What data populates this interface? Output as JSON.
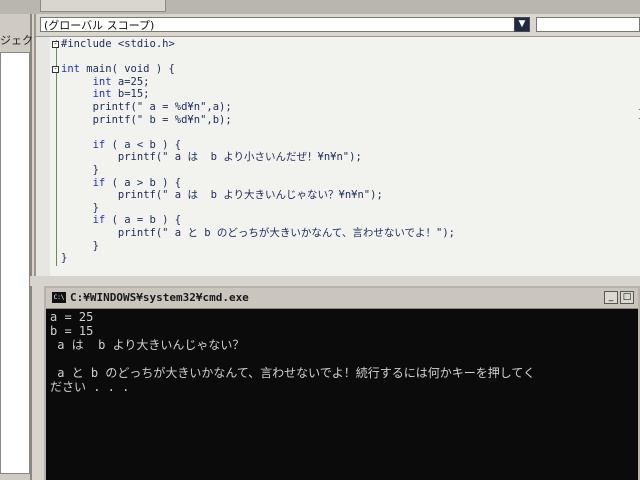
{
  "editor": {
    "scope_label": "(グローバル スコープ)",
    "code_lines": [
      {
        "fold": "-",
        "pre": "",
        "kw": "",
        "text": "#include <stdio.h>"
      },
      {
        "fold": "",
        "pre": "",
        "kw": "",
        "text": ""
      },
      {
        "fold": "-",
        "pre": "",
        "kw": "int",
        "text": " main( void ) {"
      },
      {
        "fold": "",
        "pre": "     ",
        "kw": "int",
        "text": " a=25;"
      },
      {
        "fold": "",
        "pre": "     ",
        "kw": "int",
        "text": " b=15;"
      },
      {
        "fold": "",
        "pre": "     ",
        "kw": "",
        "text": "printf(\" a = %d¥n\",a);"
      },
      {
        "fold": "",
        "pre": "     ",
        "kw": "",
        "text": "printf(\" b = %d¥n\",b);"
      },
      {
        "fold": "",
        "pre": "",
        "kw": "",
        "text": ""
      },
      {
        "fold": "",
        "pre": "     ",
        "kw": "if",
        "text": " ( a < b ) {"
      },
      {
        "fold": "",
        "pre": "         ",
        "kw": "",
        "text": "printf(\" a は  b より小さいんだぜ！¥n¥n\");"
      },
      {
        "fold": "",
        "pre": "     ",
        "kw": "",
        "text": "}"
      },
      {
        "fold": "",
        "pre": "     ",
        "kw": "if",
        "text": " ( a > b ) {"
      },
      {
        "fold": "",
        "pre": "         ",
        "kw": "",
        "text": "printf(\" a は  b より大きいんじゃない？¥n¥n\");"
      },
      {
        "fold": "",
        "pre": "     ",
        "kw": "",
        "text": "}"
      },
      {
        "fold": "",
        "pre": "     ",
        "kw": "if",
        "text": " ( a = b ) {"
      },
      {
        "fold": "",
        "pre": "         ",
        "kw": "",
        "text": "printf(\" a と b のどっちが大きいかなんて、言わせないでよ！\");"
      },
      {
        "fold": "",
        "pre": "     ",
        "kw": "",
        "text": "}"
      },
      {
        "fold": "",
        "pre": "",
        "kw": "",
        "text": "}"
      }
    ]
  },
  "left_panel": {
    "label": "ジェクト"
  },
  "console": {
    "icon_text": "C:\\",
    "title": "C:¥WINDOWS¥system32¥cmd.exe",
    "minimize_label": "_",
    "maximize_label": "□",
    "lines": [
      "a = 25",
      "b = 15",
      " a は  b より大きいんじゃない？",
      "",
      " a と b のどっちが大きいかなんて、言わせないでよ！続行するには何かキーを押してく",
      "ださい . . ."
    ]
  },
  "colors": {
    "keyword": "#2430c8",
    "code_text": "#1c2c5a",
    "console_bg": "#0b0b0b",
    "console_text": "#d0d0d0"
  }
}
